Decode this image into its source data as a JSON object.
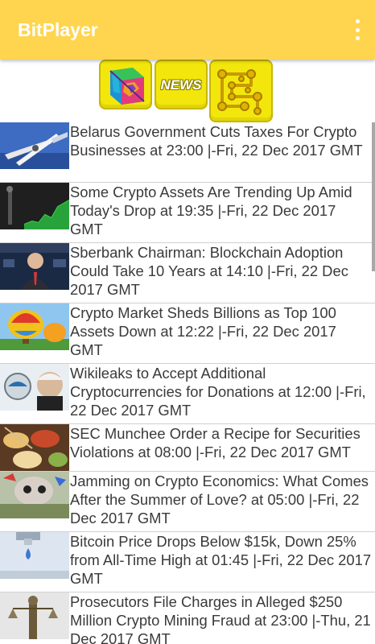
{
  "appbar": {
    "title": "BitPlayer",
    "menu_icon": "more-vert-icon"
  },
  "toolbar": {
    "tiles": [
      {
        "icon": "ethereum-cube-icon"
      },
      {
        "label": "NEWS"
      },
      {
        "icon": "circuit-board-icon"
      }
    ]
  },
  "colors": {
    "appbar": "#ffd54f",
    "tile_fill": "#f3e60c",
    "text": "#3a3a3a"
  },
  "news": [
    {
      "headline": "Belarus Government Cuts Taxes For Crypto Businesses at 23:00 |-Fri, 22 Dec 2017 GMT",
      "thumb": "scissors-image"
    },
    {
      "headline": "Some Crypto Assets Are Trending Up Amid Today's Drop at 19:35 |-Fri, 22 Dec 2017 GMT",
      "thumb": "trend-chart-image"
    },
    {
      "headline": "Sberbank Chairman: Blockchain Adoption Could Take 10 Years at 14:10 |-Fri, 22 Dec 2017 GMT",
      "thumb": "speaker-image"
    },
    {
      "headline": "Crypto Market Sheds Billions as Top 100 Assets Down at 12:22 |-Fri, 22 Dec 2017 GMT",
      "thumb": "hot-air-balloon-image"
    },
    {
      "headline": "Wikileaks to Accept Additional Cryptocurrencies for Donations at 12:00 |-Fri, 22 Dec 2017 GMT",
      "thumb": "wikileaks-image"
    },
    {
      "headline": "SEC Munchee Order a Recipe for Securities Violations at 08:00 |-Fri, 22 Dec 2017 GMT",
      "thumb": "food-bowls-image"
    },
    {
      "headline": "Jamming on Crypto Economics: What Comes After the Summer of Love? at 05:00 |-Fri, 22 Dec 2017 GMT",
      "thumb": "graffiti-image"
    },
    {
      "headline": "Bitcoin Price Drops Below $15k, Down 25% from All-Time High at 01:45 |-Fri, 22 Dec 2017 GMT",
      "thumb": "faucet-drop-image"
    },
    {
      "headline": "Prosecutors File Charges in Alleged $250 Million Crypto Mining Fraud at 23:00 |-Thu, 21 Dec 2017 GMT",
      "thumb": "justice-statue-image"
    }
  ]
}
